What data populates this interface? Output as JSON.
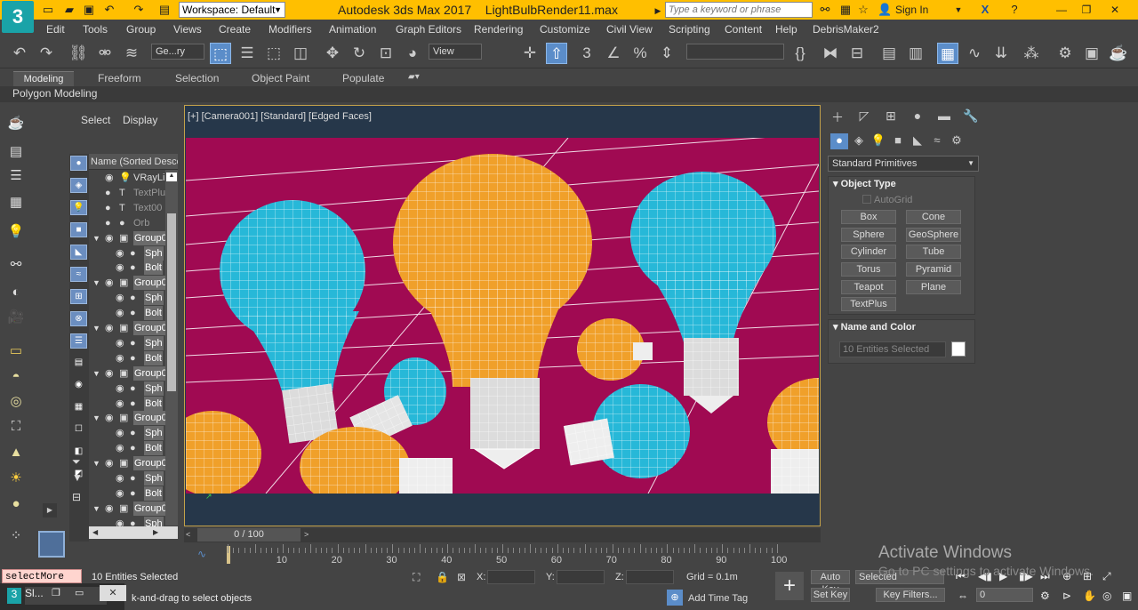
{
  "title_bar": {
    "workspace": "Workspace: Default",
    "app_name": "Autodesk 3ds Max 2017",
    "file_name": "LightBulbRender11.max",
    "search_placeholder": "Type a keyword or phrase",
    "sign_in": "Sign In",
    "app_logo": "3"
  },
  "menu": [
    "Edit",
    "Tools",
    "Group",
    "Views",
    "Create",
    "Modifiers",
    "Animation",
    "Graph Editors",
    "Rendering",
    "Customize",
    "Civil View",
    "Scripting",
    "Content",
    "Help",
    "DebrisMaker2"
  ],
  "toolbar": {
    "selection_filter": "Ge...ry",
    "ref_coord": "View",
    "snap_value": "3",
    "named_selection": ""
  },
  "ribbon": {
    "tabs": [
      "Modeling",
      "Freeform",
      "Selection",
      "Object Paint",
      "Populate"
    ],
    "active_tab": "Modeling",
    "panel": "Polygon Modeling"
  },
  "scene_explorer": {
    "tabs": [
      "Select",
      "Display"
    ],
    "column_header": "Name (Sorted Descen",
    "rows": [
      {
        "name": "VRayLig",
        "level": 0,
        "hi": false,
        "dim": false,
        "icon": "bulb"
      },
      {
        "name": "TextPlu",
        "level": 0,
        "hi": false,
        "dim": true,
        "icon": "text"
      },
      {
        "name": "Text00",
        "level": 0,
        "hi": false,
        "dim": true,
        "icon": "text"
      },
      {
        "name": "Orb",
        "level": 0,
        "hi": false,
        "dim": true,
        "icon": "dot"
      },
      {
        "name": "Group0",
        "level": 0,
        "hi": true,
        "dim": false,
        "icon": "group"
      },
      {
        "name": "Sph",
        "level": 1,
        "hi": true,
        "dim": false,
        "icon": "dot"
      },
      {
        "name": "Bolt",
        "level": 1,
        "hi": true,
        "dim": false,
        "icon": "dot"
      },
      {
        "name": "Group0",
        "level": 0,
        "hi": true,
        "dim": false,
        "icon": "group"
      },
      {
        "name": "Sph",
        "level": 1,
        "hi": true,
        "dim": false,
        "icon": "dot"
      },
      {
        "name": "Bolt",
        "level": 1,
        "hi": true,
        "dim": false,
        "icon": "dot"
      },
      {
        "name": "Group0",
        "level": 0,
        "hi": true,
        "dim": false,
        "icon": "group"
      },
      {
        "name": "Sph",
        "level": 1,
        "hi": true,
        "dim": false,
        "icon": "dot"
      },
      {
        "name": "Bolt",
        "level": 1,
        "hi": true,
        "dim": false,
        "icon": "dot"
      },
      {
        "name": "Group0",
        "level": 0,
        "hi": true,
        "dim": false,
        "icon": "group"
      },
      {
        "name": "Sph",
        "level": 1,
        "hi": true,
        "dim": false,
        "icon": "dot"
      },
      {
        "name": "Bolt",
        "level": 1,
        "hi": true,
        "dim": false,
        "icon": "dot"
      },
      {
        "name": "Group0",
        "level": 0,
        "hi": true,
        "dim": false,
        "icon": "group"
      },
      {
        "name": "Sph",
        "level": 1,
        "hi": true,
        "dim": false,
        "icon": "dot"
      },
      {
        "name": "Bolt",
        "level": 1,
        "hi": true,
        "dim": false,
        "icon": "dot"
      },
      {
        "name": "Group0",
        "level": 0,
        "hi": true,
        "dim": false,
        "icon": "group"
      },
      {
        "name": "Sph",
        "level": 1,
        "hi": true,
        "dim": false,
        "icon": "dot"
      },
      {
        "name": "Bolt",
        "level": 1,
        "hi": true,
        "dim": false,
        "icon": "dot"
      },
      {
        "name": "Group0",
        "level": 0,
        "hi": true,
        "dim": false,
        "icon": "group"
      },
      {
        "name": "Sph",
        "level": 1,
        "hi": true,
        "dim": false,
        "icon": "dot"
      }
    ]
  },
  "viewport": {
    "label": "[+] [Camera001] [Standard] [Edged Faces]",
    "background_color": "#a00a52",
    "bulb_colors": {
      "orange": "#f0a02a",
      "cyan": "#27b8d8",
      "base": "#d8d8d8"
    }
  },
  "command_panel": {
    "category": "Standard Primitives",
    "object_type_title": "Object Type",
    "autogrid": "AutoGrid",
    "buttons": [
      "Box",
      "Cone",
      "Sphere",
      "GeoSphere",
      "Cylinder",
      "Tube",
      "Torus",
      "Pyramid",
      "Teapot",
      "Plane",
      "TextPlus"
    ],
    "name_color_title": "Name and Color",
    "name_value": "10 Entities Selected",
    "swatch_color": "#ffffff"
  },
  "timeline": {
    "slider": "0 / 100",
    "ticks": [
      "10",
      "20",
      "30",
      "40",
      "50",
      "60",
      "70",
      "80",
      "90",
      "100"
    ]
  },
  "status": {
    "maxscript": "selectMore $:",
    "listener": "Sl...",
    "selection_count": "10 Entities Selected",
    "prompt": "k-and-drag to select objects",
    "x_label": "X:",
    "y_label": "Y:",
    "z_label": "Z:",
    "grid": "Grid = 0.1m",
    "add_time_tag": "Add Time Tag",
    "auto_key": "Auto Key",
    "set_key": "Set Key",
    "key_mode": "Selected",
    "key_filters": "Key Filters...",
    "frame": "0"
  },
  "watermark": {
    "line1": "Activate Windows",
    "line2": "Go to PC settings to activate Windows."
  }
}
